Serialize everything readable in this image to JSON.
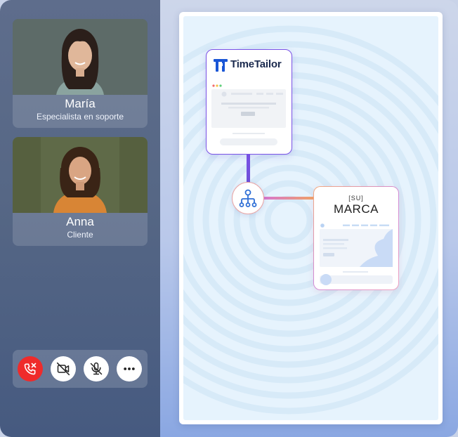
{
  "participants": [
    {
      "name": "María",
      "role": "Especialista en soporte"
    },
    {
      "name": "Anna",
      "role": "Cliente"
    }
  ],
  "controls": {
    "end_call_icon": "phone-hangup-icon",
    "video_off_icon": "video-off-icon",
    "mic_off_icon": "mic-off-icon",
    "more_icon": "more-horizontal-icon"
  },
  "integration": {
    "product_name": "TimeTailor",
    "hub_icon": "hierarchy-icon",
    "brand_top": "[SU]",
    "brand_main": "MARCA"
  },
  "colors": {
    "end_call": "#ef2b2b",
    "timetailor_accent": "#7a52e6",
    "timetailor_logo": "#1a56d6",
    "stage_bg": "#e6f3fd"
  }
}
